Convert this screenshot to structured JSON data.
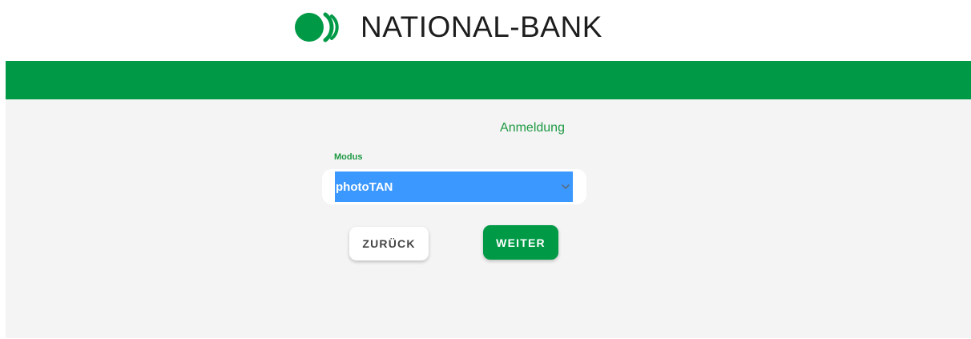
{
  "brand": {
    "name": "NATIONAL-BANK",
    "logo_icon": "bank-logo-icon",
    "accent_color": "#009a47"
  },
  "form": {
    "title": "Anmeldung",
    "mode_label": "Modus",
    "mode_selected": "photoTAN",
    "selected_bg_color": "#3b98ff"
  },
  "actions": {
    "back_label": "ZURÜCK",
    "next_label": "WEITER"
  },
  "icons": {
    "select_chevron": "chevron-down-icon"
  }
}
